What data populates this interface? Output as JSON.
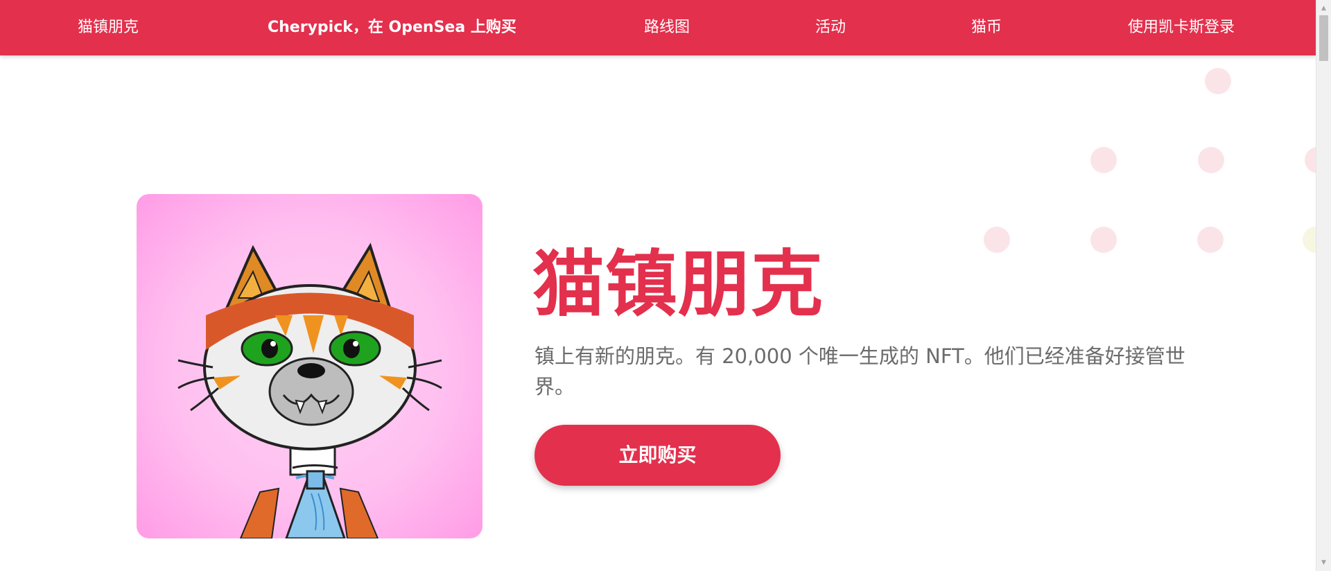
{
  "nav": {
    "brand": "猫镇朋克",
    "opensea": "Cherypick，在 OpenSea 上购买",
    "roadmap": "路线图",
    "events": "活动",
    "coin": "猫币",
    "login": "使用凯卡斯登录"
  },
  "hero": {
    "title": "猫镇朋克",
    "description": "镇上有新的朋克。有 20,000 个唯一生成的 NFT。他们已经准备好接管世界。",
    "buy_button": "立即购买",
    "image": "cat-punk-nft-image"
  },
  "colors": {
    "brand": "#e3304d",
    "image_background": "#ffc0f0",
    "text_muted": "#6b6b6b"
  }
}
